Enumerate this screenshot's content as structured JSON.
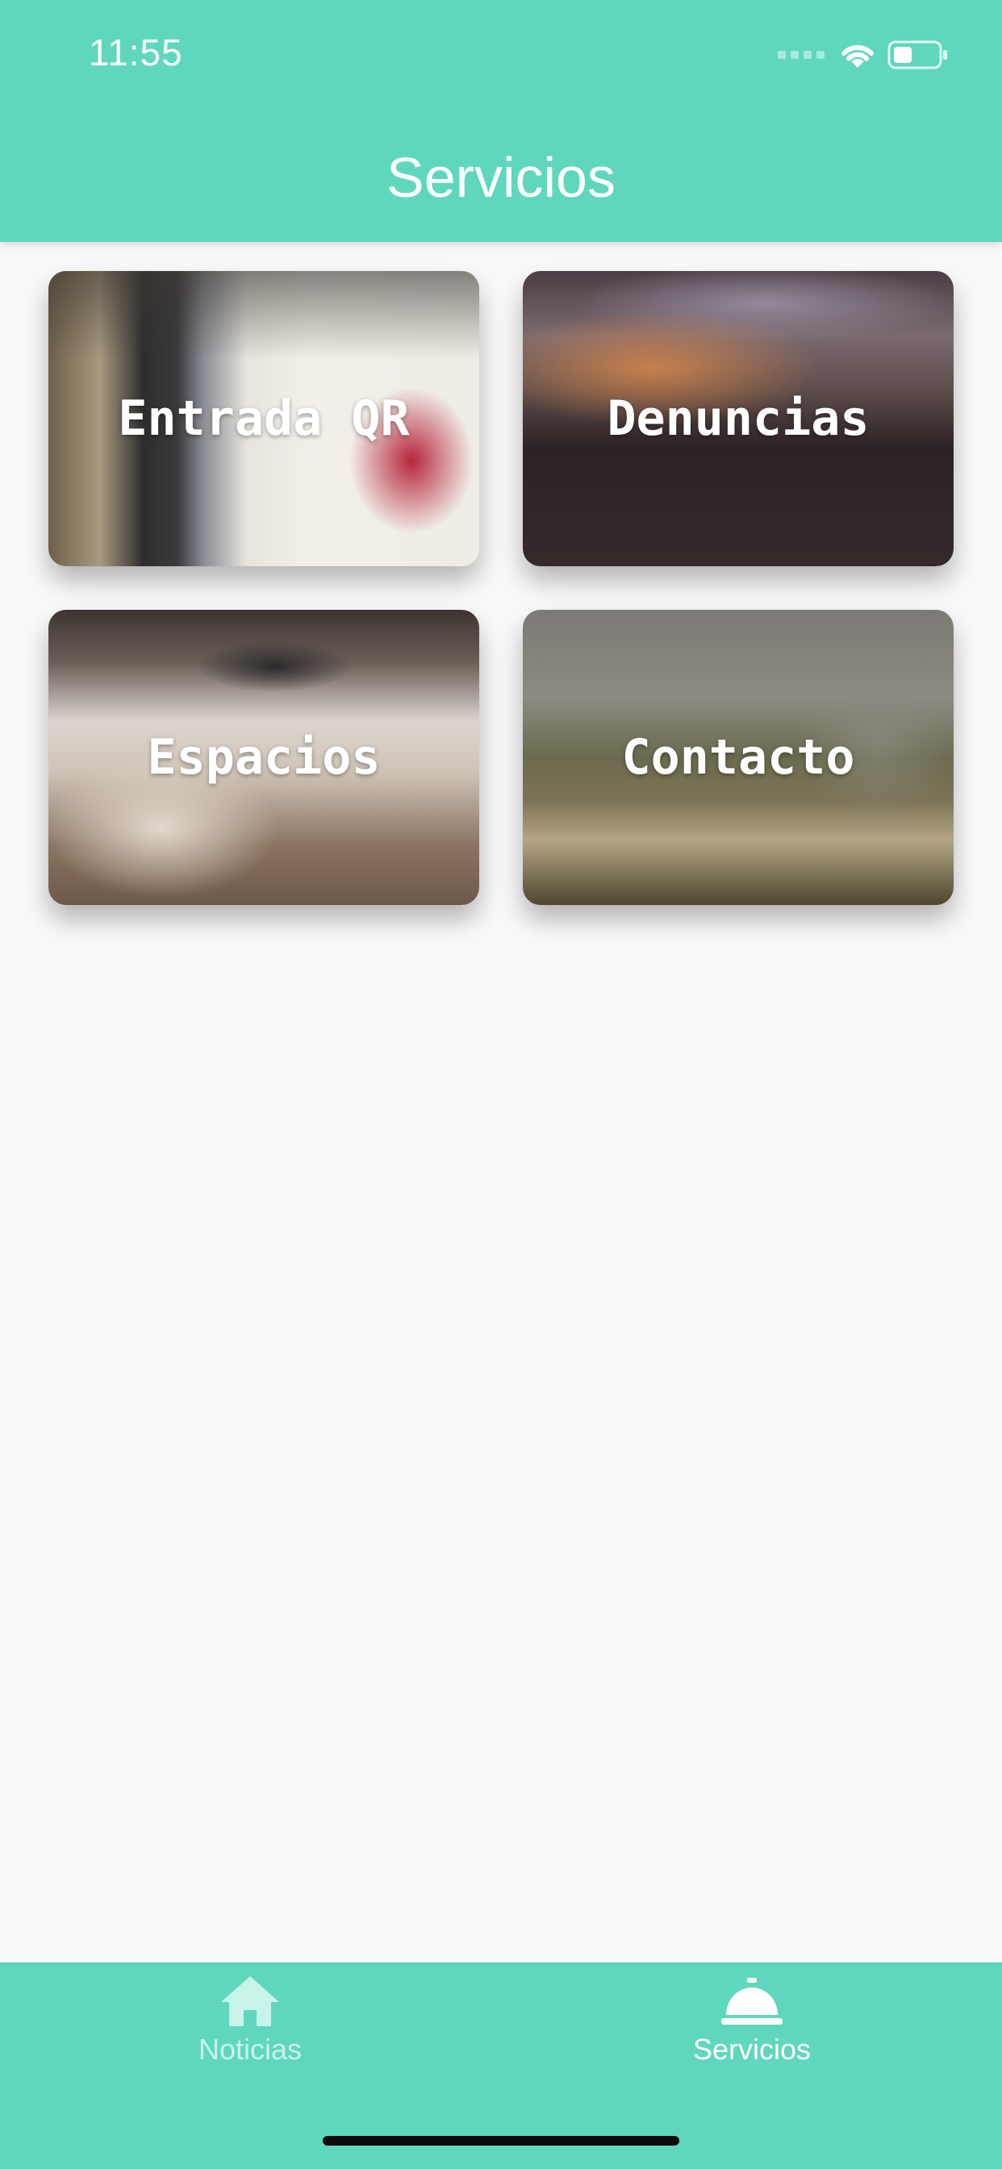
{
  "status_bar": {
    "time": "11:55",
    "icons": [
      "cellular-signal-icon",
      "wifi-icon",
      "battery-icon"
    ]
  },
  "header": {
    "title": "Servicios",
    "background_color": "#5fd7bd"
  },
  "cards": [
    {
      "label": "Entrada QR"
    },
    {
      "label": "Denuncias"
    },
    {
      "label": "Espacios"
    },
    {
      "label": "Contacto"
    }
  ],
  "tab_bar": {
    "tabs": [
      {
        "label": "Noticias",
        "icon": "home-icon",
        "active": false,
        "color": "#c8f3ea"
      },
      {
        "label": "Servicios",
        "icon": "service-bell-icon",
        "active": true,
        "color": "#ffffff"
      }
    ]
  }
}
